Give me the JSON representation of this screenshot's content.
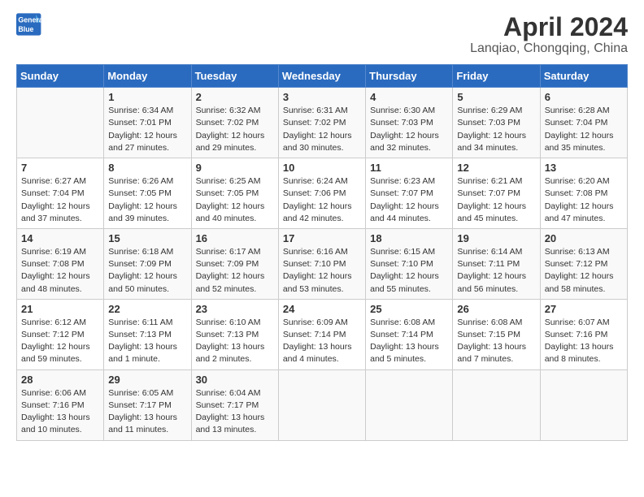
{
  "header": {
    "logo_line1": "General",
    "logo_line2": "Blue",
    "month_title": "April 2024",
    "location": "Lanqiao, Chongqing, China"
  },
  "weekdays": [
    "Sunday",
    "Monday",
    "Tuesday",
    "Wednesday",
    "Thursday",
    "Friday",
    "Saturday"
  ],
  "weeks": [
    [
      {
        "day": "",
        "info": ""
      },
      {
        "day": "1",
        "info": "Sunrise: 6:34 AM\nSunset: 7:01 PM\nDaylight: 12 hours\nand 27 minutes."
      },
      {
        "day": "2",
        "info": "Sunrise: 6:32 AM\nSunset: 7:02 PM\nDaylight: 12 hours\nand 29 minutes."
      },
      {
        "day": "3",
        "info": "Sunrise: 6:31 AM\nSunset: 7:02 PM\nDaylight: 12 hours\nand 30 minutes."
      },
      {
        "day": "4",
        "info": "Sunrise: 6:30 AM\nSunset: 7:03 PM\nDaylight: 12 hours\nand 32 minutes."
      },
      {
        "day": "5",
        "info": "Sunrise: 6:29 AM\nSunset: 7:03 PM\nDaylight: 12 hours\nand 34 minutes."
      },
      {
        "day": "6",
        "info": "Sunrise: 6:28 AM\nSunset: 7:04 PM\nDaylight: 12 hours\nand 35 minutes."
      }
    ],
    [
      {
        "day": "7",
        "info": "Sunrise: 6:27 AM\nSunset: 7:04 PM\nDaylight: 12 hours\nand 37 minutes."
      },
      {
        "day": "8",
        "info": "Sunrise: 6:26 AM\nSunset: 7:05 PM\nDaylight: 12 hours\nand 39 minutes."
      },
      {
        "day": "9",
        "info": "Sunrise: 6:25 AM\nSunset: 7:05 PM\nDaylight: 12 hours\nand 40 minutes."
      },
      {
        "day": "10",
        "info": "Sunrise: 6:24 AM\nSunset: 7:06 PM\nDaylight: 12 hours\nand 42 minutes."
      },
      {
        "day": "11",
        "info": "Sunrise: 6:23 AM\nSunset: 7:07 PM\nDaylight: 12 hours\nand 44 minutes."
      },
      {
        "day": "12",
        "info": "Sunrise: 6:21 AM\nSunset: 7:07 PM\nDaylight: 12 hours\nand 45 minutes."
      },
      {
        "day": "13",
        "info": "Sunrise: 6:20 AM\nSunset: 7:08 PM\nDaylight: 12 hours\nand 47 minutes."
      }
    ],
    [
      {
        "day": "14",
        "info": "Sunrise: 6:19 AM\nSunset: 7:08 PM\nDaylight: 12 hours\nand 48 minutes."
      },
      {
        "day": "15",
        "info": "Sunrise: 6:18 AM\nSunset: 7:09 PM\nDaylight: 12 hours\nand 50 minutes."
      },
      {
        "day": "16",
        "info": "Sunrise: 6:17 AM\nSunset: 7:09 PM\nDaylight: 12 hours\nand 52 minutes."
      },
      {
        "day": "17",
        "info": "Sunrise: 6:16 AM\nSunset: 7:10 PM\nDaylight: 12 hours\nand 53 minutes."
      },
      {
        "day": "18",
        "info": "Sunrise: 6:15 AM\nSunset: 7:10 PM\nDaylight: 12 hours\nand 55 minutes."
      },
      {
        "day": "19",
        "info": "Sunrise: 6:14 AM\nSunset: 7:11 PM\nDaylight: 12 hours\nand 56 minutes."
      },
      {
        "day": "20",
        "info": "Sunrise: 6:13 AM\nSunset: 7:12 PM\nDaylight: 12 hours\nand 58 minutes."
      }
    ],
    [
      {
        "day": "21",
        "info": "Sunrise: 6:12 AM\nSunset: 7:12 PM\nDaylight: 12 hours\nand 59 minutes."
      },
      {
        "day": "22",
        "info": "Sunrise: 6:11 AM\nSunset: 7:13 PM\nDaylight: 13 hours\nand 1 minute."
      },
      {
        "day": "23",
        "info": "Sunrise: 6:10 AM\nSunset: 7:13 PM\nDaylight: 13 hours\nand 2 minutes."
      },
      {
        "day": "24",
        "info": "Sunrise: 6:09 AM\nSunset: 7:14 PM\nDaylight: 13 hours\nand 4 minutes."
      },
      {
        "day": "25",
        "info": "Sunrise: 6:08 AM\nSunset: 7:14 PM\nDaylight: 13 hours\nand 5 minutes."
      },
      {
        "day": "26",
        "info": "Sunrise: 6:08 AM\nSunset: 7:15 PM\nDaylight: 13 hours\nand 7 minutes."
      },
      {
        "day": "27",
        "info": "Sunrise: 6:07 AM\nSunset: 7:16 PM\nDaylight: 13 hours\nand 8 minutes."
      }
    ],
    [
      {
        "day": "28",
        "info": "Sunrise: 6:06 AM\nSunset: 7:16 PM\nDaylight: 13 hours\nand 10 minutes."
      },
      {
        "day": "29",
        "info": "Sunrise: 6:05 AM\nSunset: 7:17 PM\nDaylight: 13 hours\nand 11 minutes."
      },
      {
        "day": "30",
        "info": "Sunrise: 6:04 AM\nSunset: 7:17 PM\nDaylight: 13 hours\nand 13 minutes."
      },
      {
        "day": "",
        "info": ""
      },
      {
        "day": "",
        "info": ""
      },
      {
        "day": "",
        "info": ""
      },
      {
        "day": "",
        "info": ""
      }
    ]
  ]
}
